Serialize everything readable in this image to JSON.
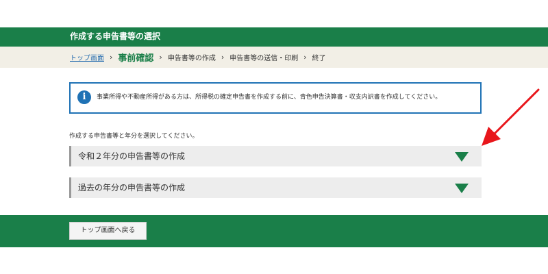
{
  "header": {
    "title": "作成する申告書等の選択"
  },
  "breadcrumb": {
    "top_link": "トップ画面",
    "current": "事前確認",
    "steps": [
      "申告書等の作成",
      "申告書等の送信・印刷",
      "終了"
    ],
    "separator": "›"
  },
  "info": {
    "icon": "info-icon",
    "icon_glyph": "i",
    "text": "事業所得や不動産所得がある方は、所得税の確定申告書を作成する前に、青色申告決算書・収支内訳書を作成してください。"
  },
  "instruction": "作成する申告書等と年分を選択してください。",
  "accordions": [
    {
      "label": "令和２年分の申告書等の作成"
    },
    {
      "label": "過去の年分の申告書等の作成"
    }
  ],
  "footer": {
    "back_button": "トップ画面へ戻る"
  },
  "colors": {
    "brand_green": "#1a7f49",
    "info_blue": "#1f72b5",
    "annotation_red": "#e8161b"
  }
}
